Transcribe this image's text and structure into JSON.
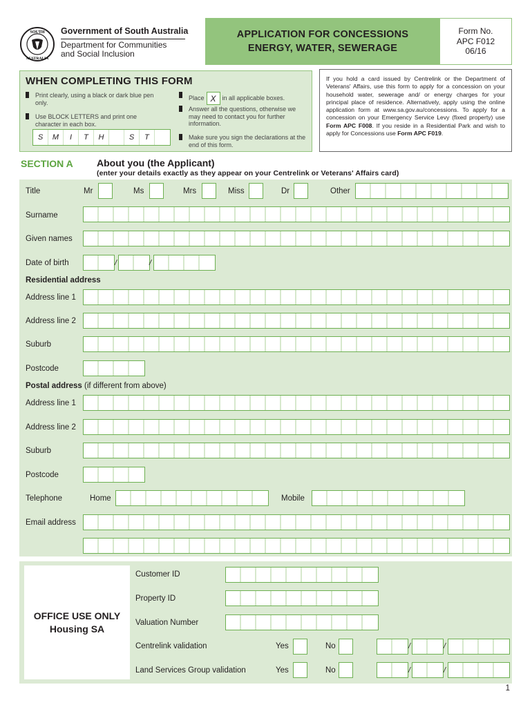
{
  "header": {
    "government": "Government of South Australia",
    "department_line1": "Department for Communities",
    "department_line2": "and Social Inclusion",
    "crest_top": "SOUTH",
    "crest_bottom": "AUSTRALIA",
    "title_line1": "APPLICATION FOR CONCESSIONS",
    "title_line2": "ENERGY, WATER, SEWERAGE",
    "form_no_label": "Form No.",
    "form_no": "APC F012",
    "form_date": "06/16"
  },
  "colors": {
    "accent_green": "#93c47d",
    "panel_green": "#dcead4",
    "box_border": "#6db051",
    "section_label": "#5da540"
  },
  "instructions": {
    "title": "WHEN COMPLETING THIS FORM",
    "bullet1": "Print clearly, using a black or dark blue pen only.",
    "bullet2": "Use BLOCK LETTERS and print one character in each box.",
    "sample_letters": [
      "S",
      "M",
      "I",
      "T",
      "H",
      "",
      "S",
      "T",
      ""
    ],
    "bullet3_before": "Place",
    "bullet3_mark": "X",
    "bullet3_after": "in all applicable boxes.",
    "bullet4": "Answer all the questions, otherwise we may need to contact you for further information.",
    "bullet5": "Make sure you sign the declarations at the end of this form."
  },
  "info": {
    "text1": "If you hold a card issued by Centrelink or the Department of Veterans' Affairs, use this form to apply for a concession on your household water, sewerage and/ or energy charges for your principal place of residence. Alternatively, apply using the online application form at www.sa.gov.au/concessions. To apply for a concession on your Emergency Service Levy (fixed property) use ",
    "bold1": "Form APC F008",
    "text2": ". If you reside in a Residential Park and wish to apply for Concessions use ",
    "bold2": "Form APC F019",
    "text3": "."
  },
  "sectionA": {
    "label": "SECTION A",
    "title": "About you (the Applicant)",
    "subtitle": "(enter your details exactly as they appear on your Centrelink or Veterans' Affairs card)",
    "title_label": "Title",
    "title_options": [
      "Mr",
      "Ms",
      "Mrs",
      "Miss",
      "Dr"
    ],
    "other_label": "Other",
    "surname": "Surname",
    "given_names": "Given names",
    "dob": "Date of birth",
    "date_sep": "/",
    "residential_heading": "Residential address",
    "address1": "Address line 1",
    "address2": "Address line 2",
    "suburb": "Suburb",
    "postcode": "Postcode",
    "postal_heading": "Postal address",
    "postal_note": " (if different from above)",
    "telephone": "Telephone",
    "home": "Home",
    "mobile": "Mobile",
    "email": "Email address"
  },
  "office": {
    "title_line1": "OFFICE USE ONLY",
    "title_line2": "Housing SA",
    "customer_id": "Customer ID",
    "property_id": "Property ID",
    "valuation_number": "Valuation Number",
    "centrelink_validation": "Centrelink validation",
    "land_services_validation": "Land Services Group validation",
    "yes": "Yes",
    "no": "No"
  },
  "page_number": "1"
}
